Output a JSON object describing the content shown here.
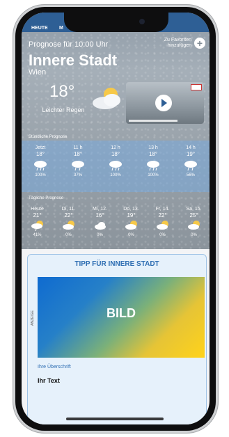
{
  "tabs": [
    "HEUTE",
    "M"
  ],
  "header": {
    "forecast_label": "Prognose für 10:00 Uhr",
    "city": "Innere Stadt",
    "region": "Wien",
    "favorite_label": "Zu Favoriten hinzufügen"
  },
  "current": {
    "temperature": "18°",
    "condition": "Leichter Regen"
  },
  "hourly": {
    "title": "Stündliche Prognose",
    "items": [
      {
        "time": "Jetzt",
        "temp": "18°",
        "precip": "100%"
      },
      {
        "time": "11 h",
        "temp": "18°",
        "precip": "37%"
      },
      {
        "time": "12 h",
        "temp": "18°",
        "precip": "100%"
      },
      {
        "time": "13 h",
        "temp": "18°",
        "precip": "100%"
      },
      {
        "time": "14 h",
        "temp": "19°",
        "precip": "56%"
      }
    ]
  },
  "daily": {
    "title": "Tägliche Prognose",
    "items": [
      {
        "day": "Heute",
        "temp": "21°",
        "precip": "41%"
      },
      {
        "day": "Di, 11.",
        "temp": "22°",
        "precip": "0%"
      },
      {
        "day": "Mi, 12.",
        "temp": "16°",
        "precip": "0%"
      },
      {
        "day": "Do, 13.",
        "temp": "19°",
        "precip": "0%"
      },
      {
        "day": "Fr, 14.",
        "temp": "22°",
        "precip": "0%"
      },
      {
        "day": "Sa, 15.",
        "temp": "25°",
        "precip": "0%"
      }
    ]
  },
  "card": {
    "title": "TIPP FÜR INNERE STADT",
    "ad_label": "ANZEIGE",
    "image_text": "BILD",
    "subtitle": "Ihre Überschrift",
    "text": "Ihr Text"
  },
  "colors": {
    "accent": "#2d6db2",
    "tabbar": "#2e5f95"
  }
}
